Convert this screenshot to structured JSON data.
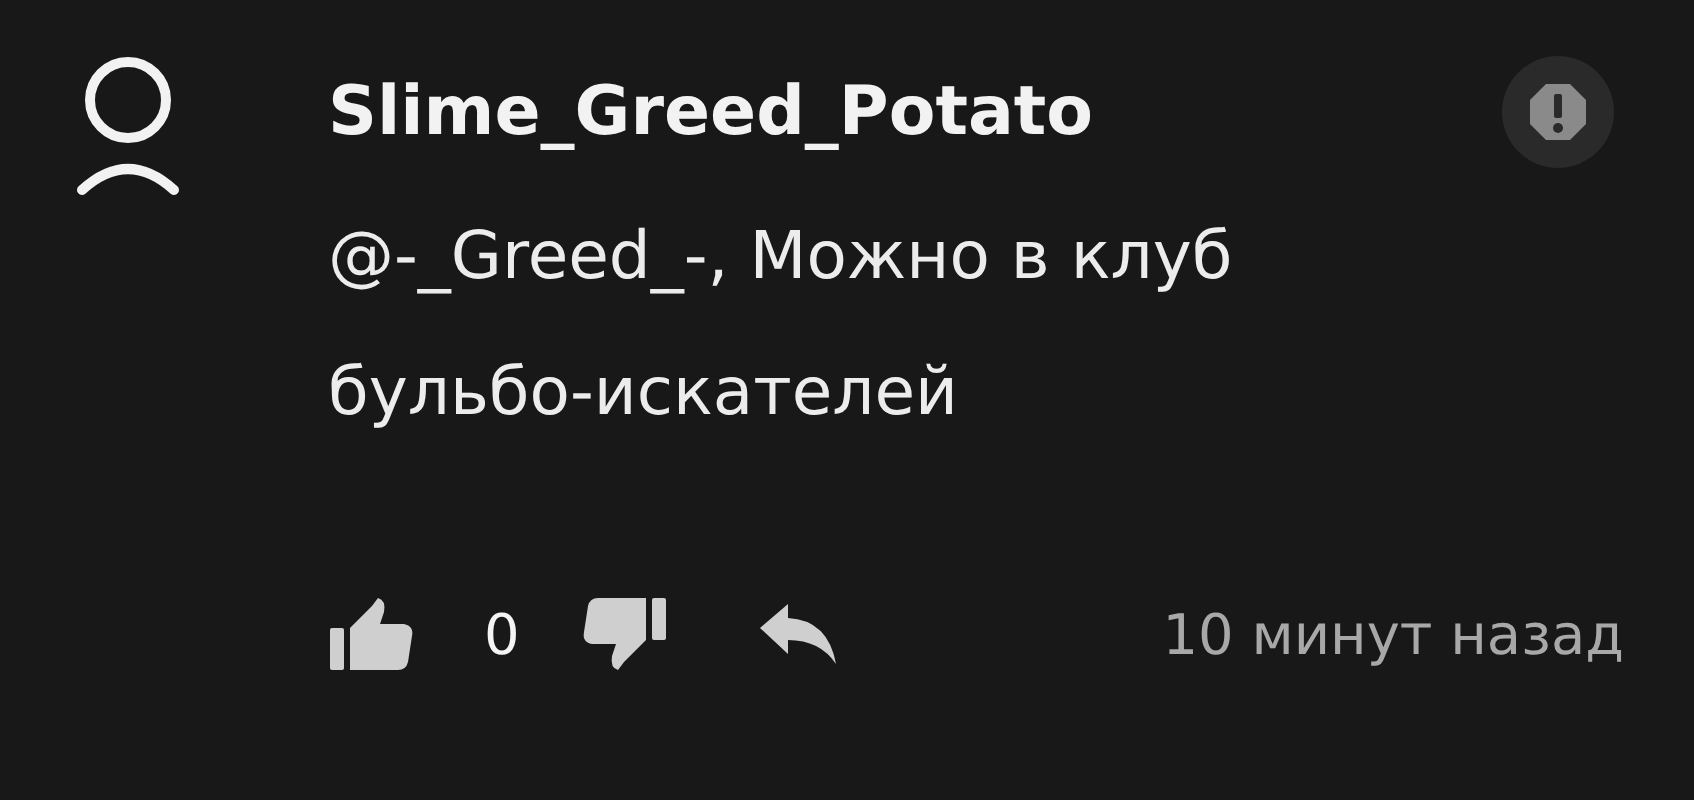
{
  "comment": {
    "author": "Slime_Greed_Potato",
    "text": "@-_Greed_-, Можно в клуб бульбо-искателей",
    "likes": "0",
    "time": "10 минут назад"
  }
}
